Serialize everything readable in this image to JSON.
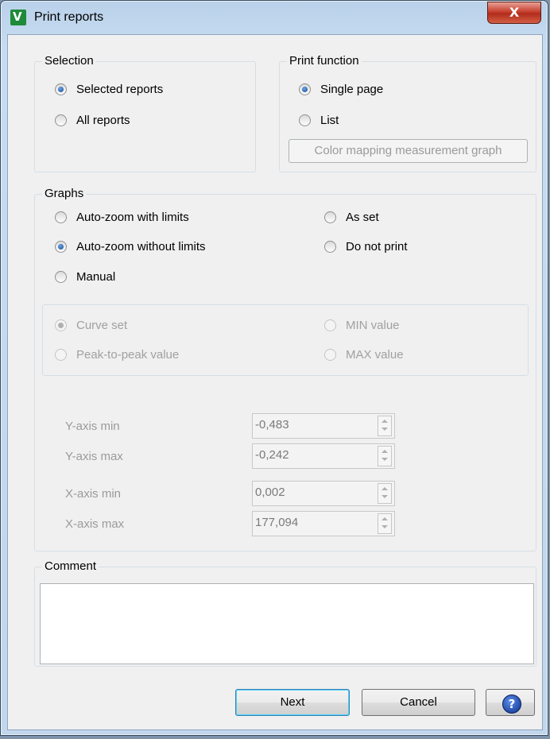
{
  "window": {
    "title": "Print reports",
    "close_glyph": "X",
    "app_icon": "app-logo-icon"
  },
  "selection": {
    "label": "Selection",
    "options": [
      {
        "label": "Selected reports",
        "checked": true
      },
      {
        "label": "All reports",
        "checked": false
      }
    ]
  },
  "print_function": {
    "label": "Print function",
    "options": [
      {
        "label": "Single page",
        "checked": true
      },
      {
        "label": "List",
        "checked": false
      }
    ],
    "color_mapping_button": "Color mapping measurement graph"
  },
  "graphs": {
    "label": "Graphs",
    "options": [
      {
        "label": "Auto-zoom with limits",
        "checked": false
      },
      {
        "label": "Auto-zoom without limits",
        "checked": true
      },
      {
        "label": "Manual",
        "checked": false
      },
      {
        "label": "As set",
        "checked": false
      },
      {
        "label": "Do not print",
        "checked": false
      }
    ],
    "sub_options": [
      {
        "label": "Curve set",
        "checked": true,
        "enabled": false
      },
      {
        "label": "Peak-to-peak value",
        "checked": false,
        "enabled": false
      },
      {
        "label": "MIN value",
        "checked": false,
        "enabled": false
      },
      {
        "label": "MAX value",
        "checked": false,
        "enabled": false
      }
    ],
    "fields": [
      {
        "label": "Y-axis min",
        "value": "-0,483"
      },
      {
        "label": "Y-axis max",
        "value": "-0,242"
      },
      {
        "label": "X-axis min",
        "value": "0,002"
      },
      {
        "label": "X-axis max",
        "value": "177,094"
      }
    ]
  },
  "comment": {
    "label": "Comment",
    "value": ""
  },
  "buttons": {
    "next": "Next",
    "cancel": "Cancel",
    "help_glyph": "?"
  },
  "colors": {
    "title_bar": "#c7dcf0",
    "close_button": "#c7402e",
    "client_bg": "#f0f0f0",
    "disabled_text": "#a0a0a0"
  }
}
